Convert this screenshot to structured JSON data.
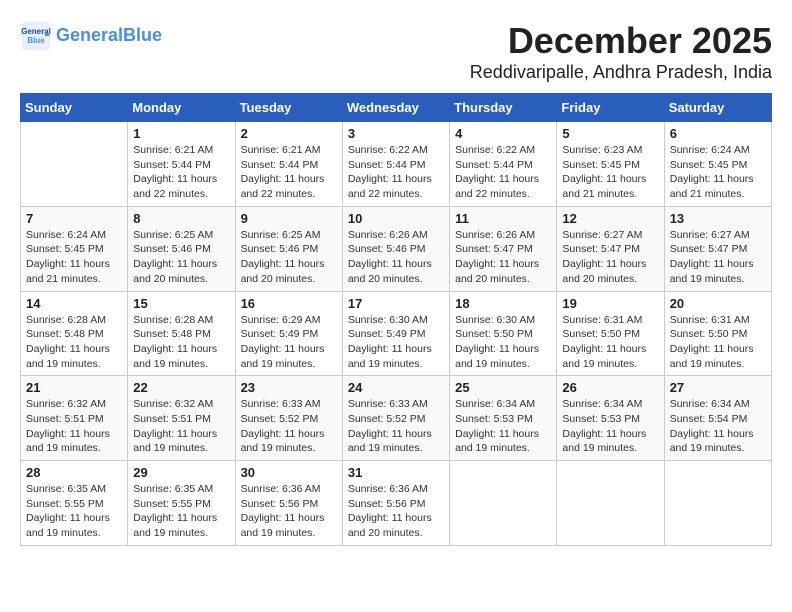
{
  "logo": {
    "line1": "General",
    "line2": "Blue"
  },
  "title": "December 2025",
  "location": "Reddivaripalle, Andhra Pradesh, India",
  "days_header": [
    "Sunday",
    "Monday",
    "Tuesday",
    "Wednesday",
    "Thursday",
    "Friday",
    "Saturday"
  ],
  "weeks": [
    [
      {
        "day": "",
        "info": ""
      },
      {
        "day": "1",
        "info": "Sunrise: 6:21 AM\nSunset: 5:44 PM\nDaylight: 11 hours\nand 22 minutes."
      },
      {
        "day": "2",
        "info": "Sunrise: 6:21 AM\nSunset: 5:44 PM\nDaylight: 11 hours\nand 22 minutes."
      },
      {
        "day": "3",
        "info": "Sunrise: 6:22 AM\nSunset: 5:44 PM\nDaylight: 11 hours\nand 22 minutes."
      },
      {
        "day": "4",
        "info": "Sunrise: 6:22 AM\nSunset: 5:44 PM\nDaylight: 11 hours\nand 22 minutes."
      },
      {
        "day": "5",
        "info": "Sunrise: 6:23 AM\nSunset: 5:45 PM\nDaylight: 11 hours\nand 21 minutes."
      },
      {
        "day": "6",
        "info": "Sunrise: 6:24 AM\nSunset: 5:45 PM\nDaylight: 11 hours\nand 21 minutes."
      }
    ],
    [
      {
        "day": "7",
        "info": "Sunrise: 6:24 AM\nSunset: 5:45 PM\nDaylight: 11 hours\nand 21 minutes."
      },
      {
        "day": "8",
        "info": "Sunrise: 6:25 AM\nSunset: 5:46 PM\nDaylight: 11 hours\nand 20 minutes."
      },
      {
        "day": "9",
        "info": "Sunrise: 6:25 AM\nSunset: 5:46 PM\nDaylight: 11 hours\nand 20 minutes."
      },
      {
        "day": "10",
        "info": "Sunrise: 6:26 AM\nSunset: 5:46 PM\nDaylight: 11 hours\nand 20 minutes."
      },
      {
        "day": "11",
        "info": "Sunrise: 6:26 AM\nSunset: 5:47 PM\nDaylight: 11 hours\nand 20 minutes."
      },
      {
        "day": "12",
        "info": "Sunrise: 6:27 AM\nSunset: 5:47 PM\nDaylight: 11 hours\nand 20 minutes."
      },
      {
        "day": "13",
        "info": "Sunrise: 6:27 AM\nSunset: 5:47 PM\nDaylight: 11 hours\nand 19 minutes."
      }
    ],
    [
      {
        "day": "14",
        "info": "Sunrise: 6:28 AM\nSunset: 5:48 PM\nDaylight: 11 hours\nand 19 minutes."
      },
      {
        "day": "15",
        "info": "Sunrise: 6:28 AM\nSunset: 5:48 PM\nDaylight: 11 hours\nand 19 minutes."
      },
      {
        "day": "16",
        "info": "Sunrise: 6:29 AM\nSunset: 5:49 PM\nDaylight: 11 hours\nand 19 minutes."
      },
      {
        "day": "17",
        "info": "Sunrise: 6:30 AM\nSunset: 5:49 PM\nDaylight: 11 hours\nand 19 minutes."
      },
      {
        "day": "18",
        "info": "Sunrise: 6:30 AM\nSunset: 5:50 PM\nDaylight: 11 hours\nand 19 minutes."
      },
      {
        "day": "19",
        "info": "Sunrise: 6:31 AM\nSunset: 5:50 PM\nDaylight: 11 hours\nand 19 minutes."
      },
      {
        "day": "20",
        "info": "Sunrise: 6:31 AM\nSunset: 5:50 PM\nDaylight: 11 hours\nand 19 minutes."
      }
    ],
    [
      {
        "day": "21",
        "info": "Sunrise: 6:32 AM\nSunset: 5:51 PM\nDaylight: 11 hours\nand 19 minutes."
      },
      {
        "day": "22",
        "info": "Sunrise: 6:32 AM\nSunset: 5:51 PM\nDaylight: 11 hours\nand 19 minutes."
      },
      {
        "day": "23",
        "info": "Sunrise: 6:33 AM\nSunset: 5:52 PM\nDaylight: 11 hours\nand 19 minutes."
      },
      {
        "day": "24",
        "info": "Sunrise: 6:33 AM\nSunset: 5:52 PM\nDaylight: 11 hours\nand 19 minutes."
      },
      {
        "day": "25",
        "info": "Sunrise: 6:34 AM\nSunset: 5:53 PM\nDaylight: 11 hours\nand 19 minutes."
      },
      {
        "day": "26",
        "info": "Sunrise: 6:34 AM\nSunset: 5:53 PM\nDaylight: 11 hours\nand 19 minutes."
      },
      {
        "day": "27",
        "info": "Sunrise: 6:34 AM\nSunset: 5:54 PM\nDaylight: 11 hours\nand 19 minutes."
      }
    ],
    [
      {
        "day": "28",
        "info": "Sunrise: 6:35 AM\nSunset: 5:55 PM\nDaylight: 11 hours\nand 19 minutes."
      },
      {
        "day": "29",
        "info": "Sunrise: 6:35 AM\nSunset: 5:55 PM\nDaylight: 11 hours\nand 19 minutes."
      },
      {
        "day": "30",
        "info": "Sunrise: 6:36 AM\nSunset: 5:56 PM\nDaylight: 11 hours\nand 19 minutes."
      },
      {
        "day": "31",
        "info": "Sunrise: 6:36 AM\nSunset: 5:56 PM\nDaylight: 11 hours\nand 20 minutes."
      },
      {
        "day": "",
        "info": ""
      },
      {
        "day": "",
        "info": ""
      },
      {
        "day": "",
        "info": ""
      }
    ]
  ]
}
